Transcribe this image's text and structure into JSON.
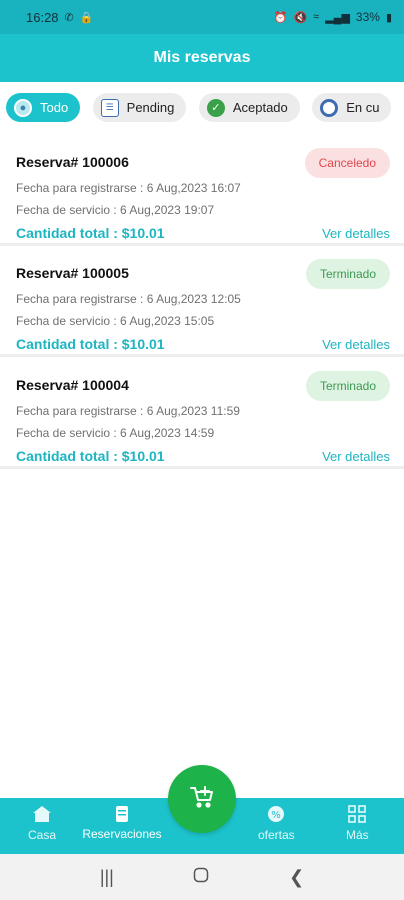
{
  "status_bar": {
    "time": "16:28",
    "battery": "33%"
  },
  "header": {
    "title": "Mis reservas"
  },
  "filters": [
    {
      "label": "Todo",
      "icon": "radio-icon",
      "active": true
    },
    {
      "label": "Pending",
      "icon": "clipboard-icon",
      "active": false
    },
    {
      "label": "Aceptado",
      "icon": "check-circle-icon",
      "active": false
    },
    {
      "label": "En cu",
      "icon": "gear-icon",
      "active": false
    }
  ],
  "bookings": [
    {
      "title": "Reserva# 100006",
      "status": "Canceledo",
      "status_type": "cancel",
      "register_date": "Fecha para registrarse : 6 Aug,2023 16:07",
      "service_date": "Fecha de servicio : 6 Aug,2023 19:07",
      "total": "Cantidad total : $10.01",
      "details_label": "Ver detalles"
    },
    {
      "title": "Reserva# 100005",
      "status": "Terminado",
      "status_type": "done",
      "register_date": "Fecha para registrarse : 6 Aug,2023 12:05",
      "service_date": "Fecha de servicio : 6 Aug,2023 15:05",
      "total": "Cantidad total : $10.01",
      "details_label": "Ver detalles"
    },
    {
      "title": "Reserva# 100004",
      "status": "Terminado",
      "status_type": "done",
      "register_date": "Fecha para registrarse : 6 Aug,2023 11:59",
      "service_date": "Fecha de servicio : 6 Aug,2023 14:59",
      "total": "Cantidad total : $10.01",
      "details_label": "Ver detalles"
    }
  ],
  "bottom_nav": {
    "casa": "Casa",
    "reservaciones": "Reservaciones",
    "ofertas": "ofertas",
    "mas": "Más"
  },
  "colors": {
    "primary": "#1cc3cc",
    "fab": "#1db24a",
    "cancel": "#e0474f",
    "done": "#3d9a52"
  }
}
